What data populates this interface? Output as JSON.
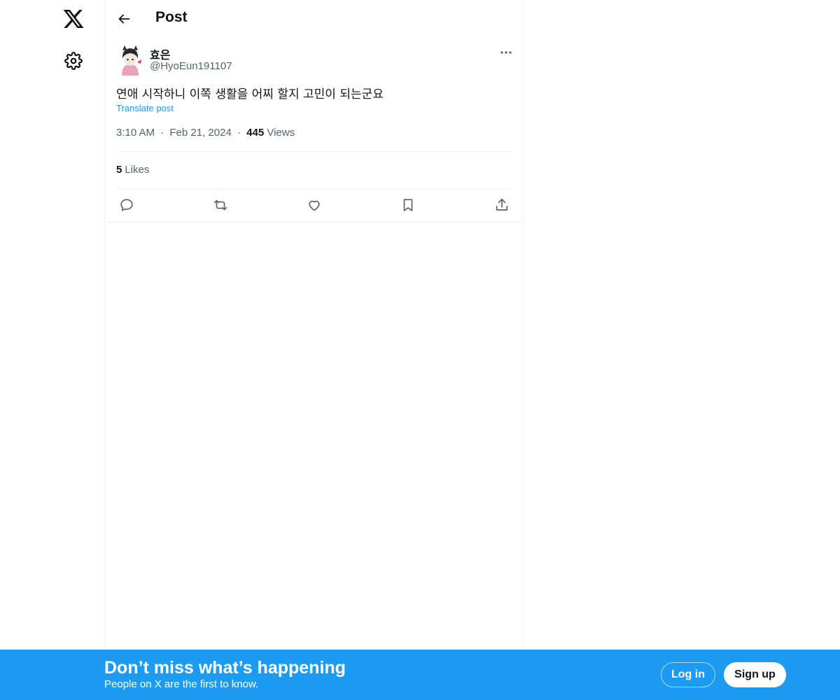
{
  "header": {
    "title": "Post"
  },
  "author": {
    "name": "효은",
    "handle": "@HyoEun191107"
  },
  "post": {
    "text": "연애 시작하니 이쪽 생활을 어찌 할지 고민이 되는군요",
    "translate_label": "Translate post",
    "time": "3:10 AM",
    "separator": "·",
    "date": "Feb 21, 2024",
    "views_count": "445",
    "views_label": "Views",
    "likes_count": "5",
    "likes_label": "Likes"
  },
  "actions": [
    "reply-icon",
    "repost-icon",
    "like-icon",
    "bookmark-icon",
    "share-icon"
  ],
  "banner": {
    "title": "Don’t miss what’s happening",
    "subtitle": "People on X are the first to know.",
    "login_label": "Log in",
    "signup_label": "Sign up"
  },
  "colors": {
    "accent": "#1d9bf0",
    "text_primary": "#0f1419",
    "text_secondary": "#536471",
    "divider": "#eff3f4"
  }
}
